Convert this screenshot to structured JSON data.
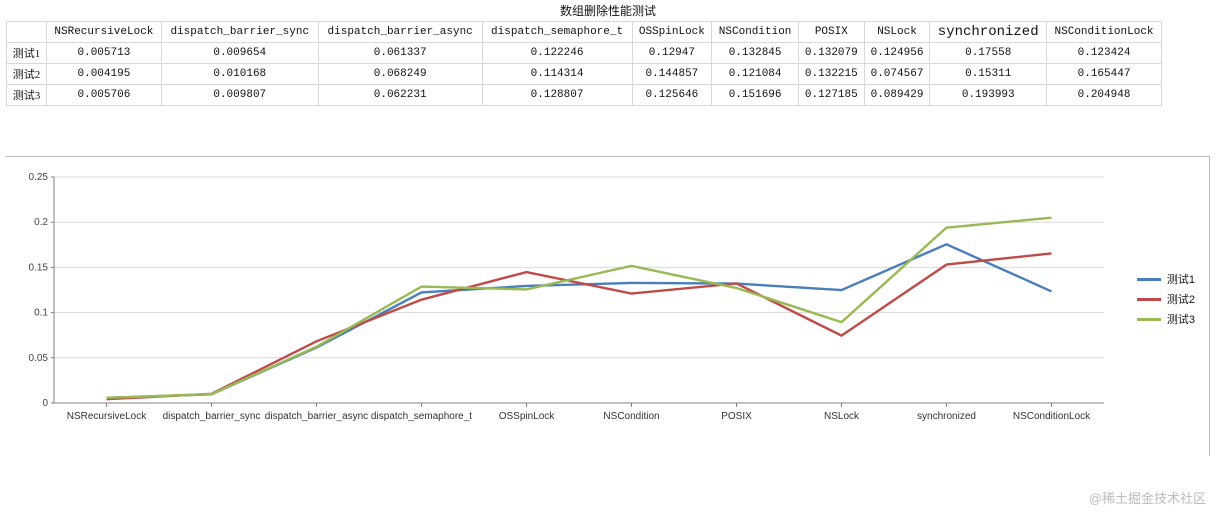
{
  "title": "数组删除性能测试",
  "columns": [
    "NSRecursiveLock",
    "dispatch_barrier_sync",
    "dispatch_barrier_async",
    "dispatch_semaphore_t",
    "OSSpinLock",
    "NSCondition",
    "POSIX",
    "NSLock",
    "synchronized",
    "NSConditionLock"
  ],
  "rows": [
    {
      "label": "测试1",
      "values": [
        "0.005713",
        "0.009654",
        "0.061337",
        "0.122246",
        "0.12947",
        "0.132845",
        "0.132079",
        "0.124956",
        "0.17558",
        "0.123424"
      ]
    },
    {
      "label": "测试2",
      "values": [
        "0.004195",
        "0.010168",
        "0.068249",
        "0.114314",
        "0.144857",
        "0.121084",
        "0.132215",
        "0.074567",
        "0.15311",
        "0.165447"
      ]
    },
    {
      "label": "测试3",
      "values": [
        "0.005706",
        "0.009807",
        "0.062231",
        "0.128807",
        "0.125646",
        "0.151696",
        "0.127185",
        "0.089429",
        "0.193993",
        "0.204948"
      ]
    }
  ],
  "legend": {
    "s1": "测试1",
    "s2": "测试2",
    "s3": "测试3"
  },
  "colors": {
    "s1": "#4a7ebb",
    "s2": "#be4b48",
    "s3": "#98b954",
    "grid": "#d9d9d9",
    "axis": "#828282"
  },
  "watermark": "@稀土掘金技术社区",
  "chart_data": {
    "type": "line",
    "title": "数组删除性能测试",
    "xlabel": "",
    "ylabel": "",
    "ylim": [
      0,
      0.25
    ],
    "yticks": [
      0,
      0.05,
      0.1,
      0.15,
      0.2,
      0.25
    ],
    "categories": [
      "NSRecursiveLock",
      "dispatch_barrier_sync",
      "dispatch_barrier_async",
      "dispatch_semaphore_t",
      "OSSpinLock",
      "NSCondition",
      "POSIX",
      "NSLock",
      "synchronized",
      "NSConditionLock"
    ],
    "series": [
      {
        "name": "测试1",
        "color": "#4a7ebb",
        "values": [
          0.005713,
          0.009654,
          0.061337,
          0.122246,
          0.12947,
          0.132845,
          0.132079,
          0.124956,
          0.17558,
          0.123424
        ]
      },
      {
        "name": "测试2",
        "color": "#be4b48",
        "values": [
          0.004195,
          0.010168,
          0.068249,
          0.114314,
          0.144857,
          0.121084,
          0.132215,
          0.074567,
          0.15311,
          0.165447
        ]
      },
      {
        "name": "测试3",
        "color": "#98b954",
        "values": [
          0.005706,
          0.009807,
          0.062231,
          0.128807,
          0.125646,
          0.151696,
          0.127185,
          0.089429,
          0.193993,
          0.204948
        ]
      }
    ]
  }
}
